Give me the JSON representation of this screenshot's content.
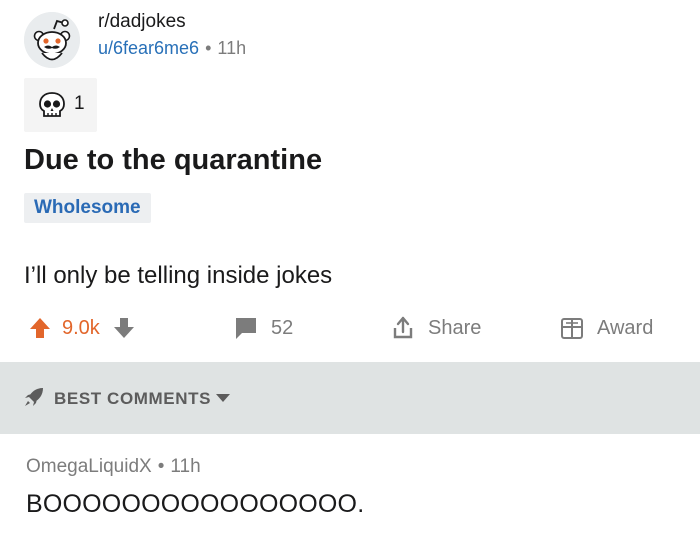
{
  "post": {
    "subreddit": "r/dadjokes",
    "author": "u/6fear6me6",
    "separator": "•",
    "age": "11h",
    "award_count": "1",
    "title": "Due to the quarantine",
    "flair": "Wholesome",
    "body": "I’ll only be telling inside jokes"
  },
  "actions": {
    "score": "9.0k",
    "comments": "52",
    "share": "Share",
    "award": "Award"
  },
  "sort": {
    "label": "BEST COMMENTS"
  },
  "comment": {
    "author": "OmegaLiquidX",
    "separator": "•",
    "age": "11h",
    "body": "BOOOOOOOOOOOOOOOO."
  },
  "colors": {
    "upvote": "#e2662b",
    "username": "#2870b8",
    "flair_text": "#2a6ab5",
    "sort_bar_bg": "#dfe3e3"
  },
  "icons": {
    "avatar": "snoo-avatar-icon",
    "award": "skull-award-icon",
    "upvote": "upvote-arrow-icon",
    "downvote": "downvote-arrow-icon",
    "comments": "comment-bubble-icon",
    "share": "share-icon",
    "award_button": "gift-box-icon",
    "sort": "rocket-icon",
    "caret": "caret-down-icon"
  }
}
